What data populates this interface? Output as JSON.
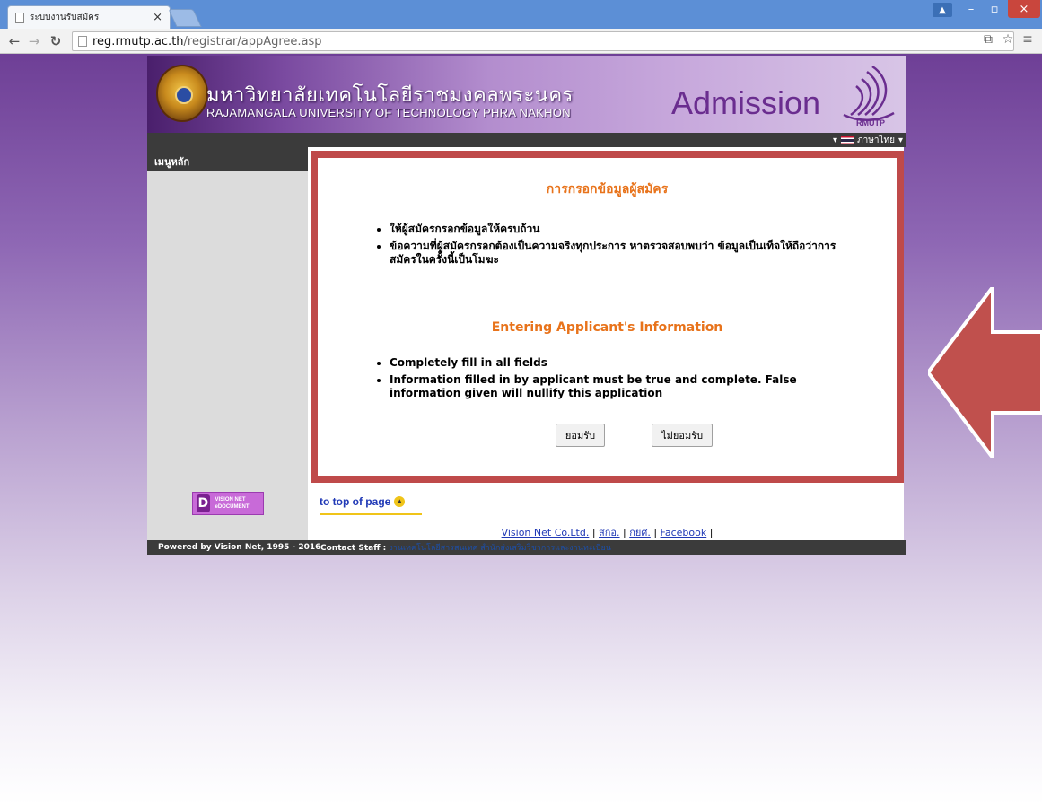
{
  "browser": {
    "tab_title": "ระบบงานรับสมัคร",
    "tab_close": "×",
    "url_host": "reg.rmutp.ac.th",
    "url_path": "/registrar/appAgree.asp",
    "win_user": "▲",
    "win_min": "–",
    "win_max": "▫",
    "win_close": "×"
  },
  "site": {
    "university_th": "มหาวิทยาลัยเทคโนโลยีราชมงคลพระนคร",
    "university_en": "RAJAMANGALA UNIVERSITY OF TECHNOLOGY PHRA NAKHON",
    "admission_label": "Admission",
    "logo_abbr": "RMUTP",
    "language": "ภาษาไทย"
  },
  "sidebar": {
    "heading": "เมนูหลัก",
    "vision_logo_text": "VISION NET eDOCUMENT"
  },
  "agreement": {
    "title_th": "การกรอกข้อมูลผู้สมัคร",
    "terms_th": [
      "ให้ผู้สมัครกรอกข้อมูลให้ครบถ้วน",
      "ข้อความที่ผู้สมัครกรอกต้องเป็นความจริงทุกประการ หาตรวจสอบพบว่า ข้อมูลเป็นเท็จให้ถือว่าการสมัครในครั้งนี้เป็นโมฆะ"
    ],
    "title_en": "Entering Applicant's Information",
    "terms_en": [
      "Completely fill in all fields",
      "Information filled in by applicant must be true and complete. False information given will nullify this application"
    ],
    "accept_label": "ยอมรับ",
    "decline_label": "ไม่ยอมรับ"
  },
  "footer": {
    "to_top": "to top of page",
    "links": [
      "Vision Net Co.Ltd.",
      "สกอ.",
      "กยศ.",
      "Facebook"
    ],
    "powered_by": "Powered by Vision Net, 1995 - 2016",
    "contact_label": "Contact Staff :",
    "contact_link": "งานเทคโนโลยีสารสนเทศ สำนักส่งเสริมวิชาการและงานทะเบียน"
  },
  "colors": {
    "accent_orange": "#e8731b",
    "frame_red": "#bf4a4a",
    "arrow_red": "#c0504d"
  }
}
